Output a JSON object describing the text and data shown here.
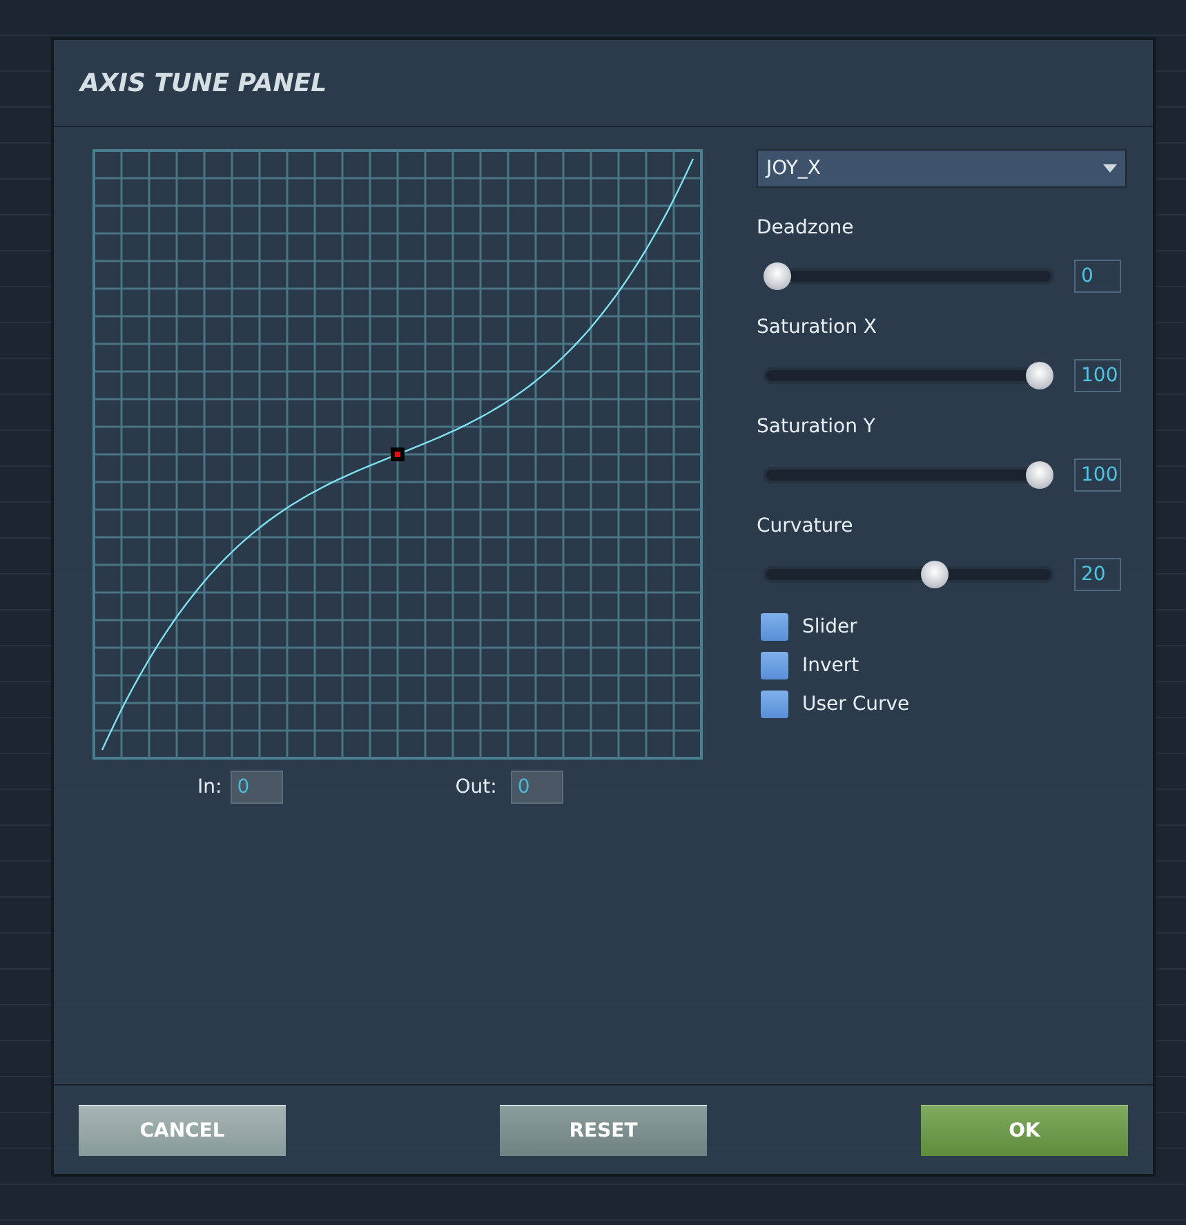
{
  "window": {
    "title": "AXIS TUNE PANEL"
  },
  "graph": {
    "in_label": "In:",
    "in_value": "0",
    "out_label": "Out:",
    "out_value": "0"
  },
  "axis_dropdown": {
    "value": "JOY_X"
  },
  "sliders": [
    {
      "label": "Deadzone",
      "level": 0,
      "value": "0"
    },
    {
      "label": "Saturation X",
      "level": 1,
      "value": "100"
    },
    {
      "label": "Saturation Y",
      "level": 1,
      "value": "100"
    },
    {
      "label": "Curvature",
      "level": 0.6,
      "value": "20"
    }
  ],
  "checkboxes": [
    {
      "label": "Slider",
      "checked": false
    },
    {
      "label": "Invert",
      "checked": false
    },
    {
      "label": "User Curve",
      "checked": false
    }
  ],
  "buttons": [
    {
      "label": "CANCEL",
      "kind": "cancel"
    },
    {
      "label": "RESET",
      "kind": "reset"
    },
    {
      "label": "OK",
      "kind": "ok"
    }
  ]
}
